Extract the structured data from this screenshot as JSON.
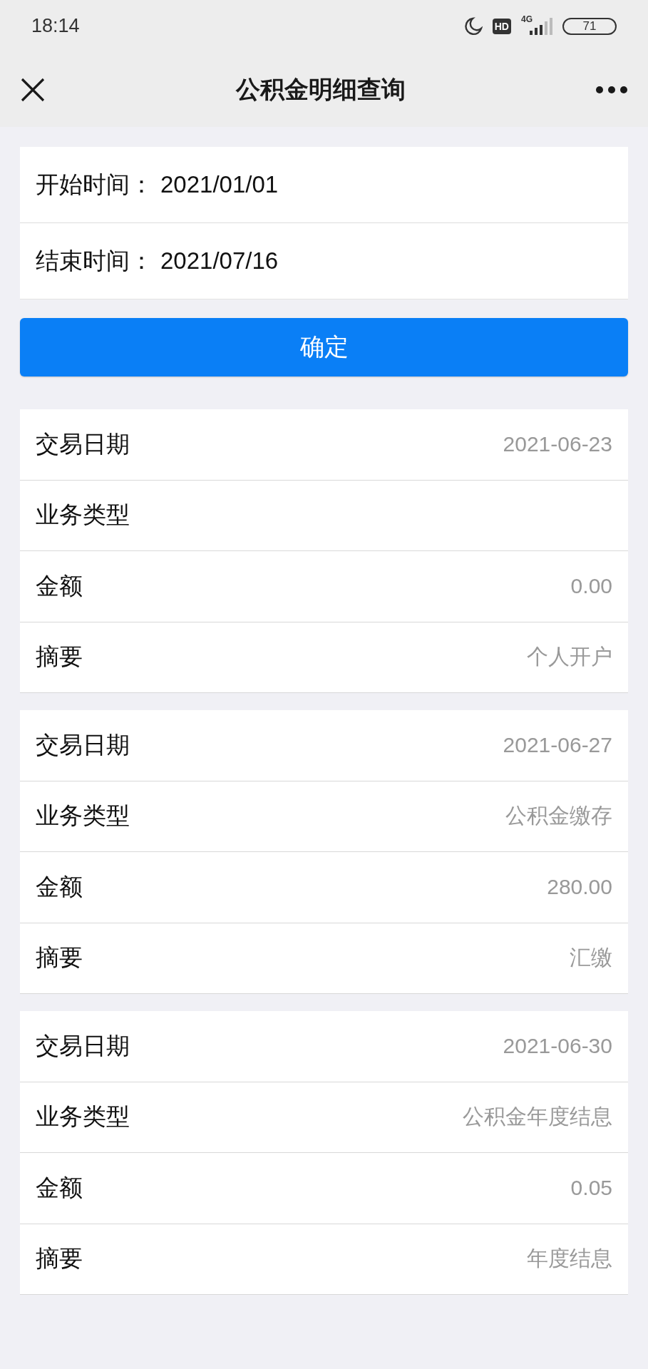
{
  "status_bar": {
    "time": "18:14",
    "hd_badge": "HD",
    "network": "4G",
    "battery": "71"
  },
  "nav": {
    "title": "公积金明细查询"
  },
  "query": {
    "fields": [
      {
        "label": "开始时间：",
        "value": "2021/01/01"
      },
      {
        "label": "结束时间：",
        "value": "2021/07/16"
      }
    ],
    "button": "确定"
  },
  "records": [
    {
      "rows": [
        {
          "label": "交易日期",
          "value": "2021-06-23"
        },
        {
          "label": "业务类型"
        },
        {
          "label": "金额",
          "value": "0.00"
        },
        {
          "label": "摘要",
          "value": "个人开户"
        }
      ]
    },
    {
      "rows": [
        {
          "label": "交易日期",
          "value": "2021-06-27"
        },
        {
          "label": "业务类型",
          "value": "公积金缴存"
        },
        {
          "label": "金额",
          "value": "280.00"
        },
        {
          "label": "摘要",
          "value": "汇缴"
        }
      ]
    },
    {
      "rows": [
        {
          "label": "交易日期",
          "value": "2021-06-30"
        },
        {
          "label": "业务类型",
          "value": "公积金年度结息"
        },
        {
          "label": "金额",
          "value": "0.05"
        },
        {
          "label": "摘要",
          "value": "年度结息"
        }
      ]
    }
  ]
}
